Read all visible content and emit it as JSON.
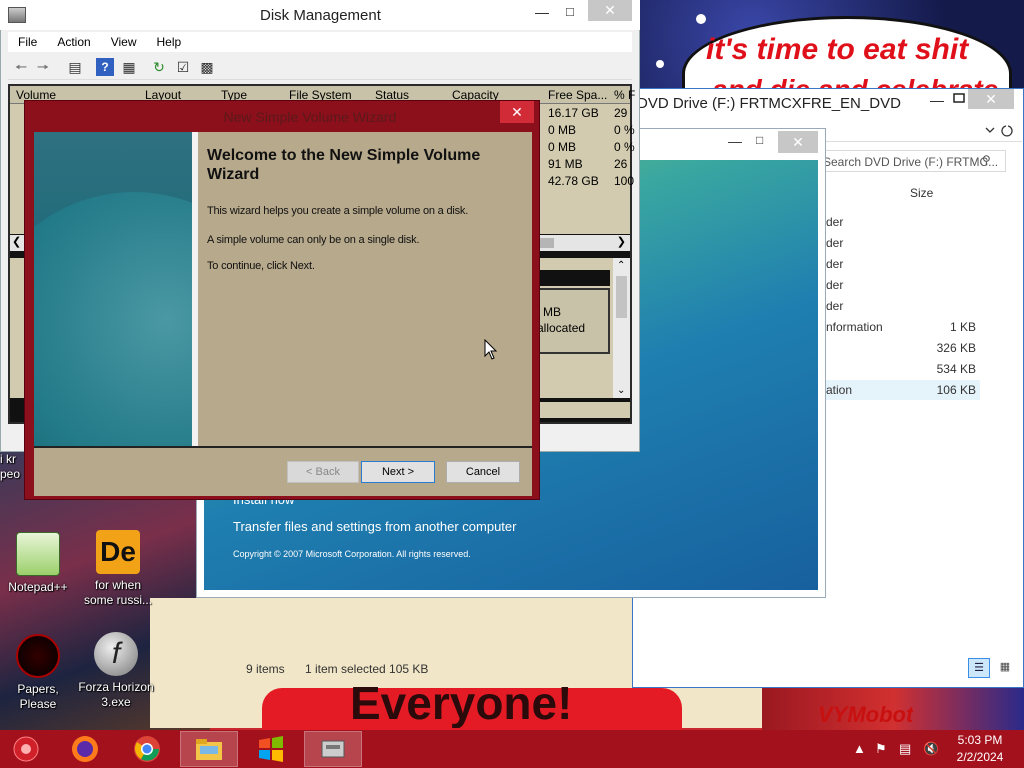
{
  "wallpaper": {
    "meme_text": "it's time to eat shit",
    "meme_text_2": "and die and celebrate",
    "banner": "Everyone!",
    "sticker": "VYMobot"
  },
  "disk_management": {
    "title": "Disk Management",
    "menu": [
      "File",
      "Action",
      "View",
      "Help"
    ],
    "columns": [
      "Volume",
      "Layout",
      "Type",
      "File System",
      "Status",
      "Capacity",
      "Free Spa...",
      "% F"
    ],
    "rows": [
      {
        "free": "16.17 GB",
        "pct": "29"
      },
      {
        "free": "0 MB",
        "pct": "0 %"
      },
      {
        "free": "0 MB",
        "pct": "0 %"
      },
      {
        "free": "91 MB",
        "pct": "26"
      },
      {
        "free": "42.78 GB",
        "pct": "100"
      }
    ],
    "partition_size": "MB",
    "partition_state": "allocated"
  },
  "wizard": {
    "title": "New Simple Volume Wizard",
    "heading": "Welcome to the New Simple Volume Wizard",
    "line1": "This wizard helps you create a simple volume on a disk.",
    "line2": "A simple volume can only be on a single disk.",
    "line3": "To continue, click Next.",
    "back": "< Back",
    "next": "Next >",
    "cancel": "Cancel"
  },
  "explorer": {
    "title": "DVD Drive (F:) FRTMCXFRE_EN_DVD",
    "search_placeholder": "Search DVD Drive (F:) FRTMC...",
    "col_size": "Size",
    "rows": [
      {
        "name": "der",
        "size": ""
      },
      {
        "name": "der",
        "size": ""
      },
      {
        "name": "der",
        "size": ""
      },
      {
        "name": "der",
        "size": ""
      },
      {
        "name": "der",
        "size": ""
      },
      {
        "name": "nformation",
        "size": "1 KB"
      },
      {
        "name": "",
        "size": "326 KB"
      },
      {
        "name": "",
        "size": "534 KB"
      },
      {
        "name": "ation",
        "size": "106 KB"
      }
    ],
    "status_items": "9 items",
    "status_selected": "1 item selected  105 KB"
  },
  "setup": {
    "link_partial": "Install now",
    "link": "Transfer files and settings from another computer",
    "copyright": "Copyright © 2007 Microsoft Corporation. All rights reserved."
  },
  "desktop": {
    "icons": [
      {
        "label": "Notepad++"
      },
      {
        "label": "for when some russi..."
      },
      {
        "label": "Papers, Please"
      },
      {
        "label": "Forza Horizon 3.exe"
      }
    ],
    "partial_label": "i kr peo"
  },
  "clock": {
    "time": "5:03 PM",
    "date": "2/2/2024"
  },
  "colors": {
    "taskbar": "#a3111d",
    "wizard_frame": "#8c0f1c",
    "wizard_body": "#b7a98c",
    "accent": "#2d7bd0"
  }
}
